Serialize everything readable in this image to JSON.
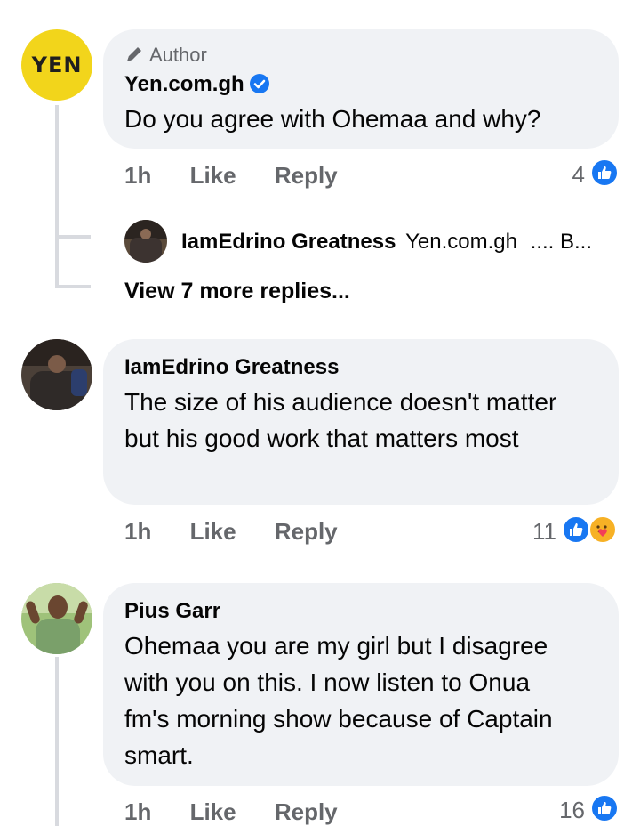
{
  "comments": [
    {
      "author_tag": "Author",
      "author": "Yen.com.gh",
      "avatar_text": "YEN",
      "verified": true,
      "text": "Do you agree with Ohemaa and why?",
      "time": "1h",
      "like_label": "Like",
      "reply_label": "Reply",
      "reaction_count": "4",
      "reactions": [
        "like"
      ]
    },
    {
      "author": "IamEdrino Greatness",
      "text": "The size of his audience doesn't matter but his good work that matters most",
      "time": "1h",
      "like_label": "Like",
      "reply_label": "Reply",
      "reaction_count": "11",
      "reactions": [
        "like",
        "care"
      ]
    },
    {
      "author": "Pius Garr",
      "text": "Ohemaa you are my girl but I disagree with you on this. I now listen to Onua fm's morning show because of Captain smart.",
      "time": "1h",
      "like_label": "Like",
      "reply_label": "Reply",
      "reaction_count": "16",
      "reactions": [
        "like"
      ]
    }
  ],
  "reply_preview": {
    "author": "IamEdrino Greatness",
    "mention": "Yen.com.gh",
    "snippet": ".... B..."
  },
  "view_more": "View 7 more replies...",
  "colors": {
    "bubble": "#f0f2f5",
    "meta": "#65676b",
    "like_blue": "#1877f2",
    "yen_yellow": "#f2d51b",
    "thread_line": "#d8dadf"
  }
}
